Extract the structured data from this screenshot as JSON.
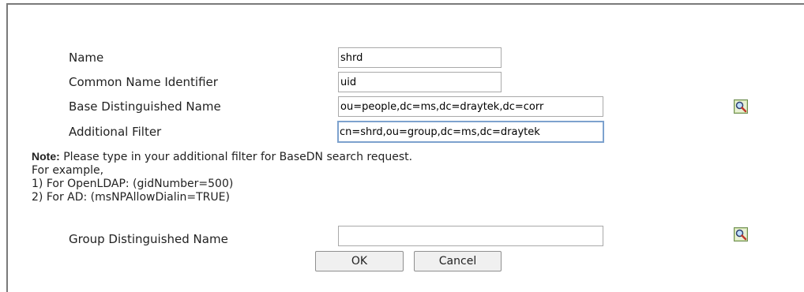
{
  "form": {
    "name_label": "Name",
    "name_value": "shrd",
    "cn_label": "Common Name Identifier",
    "cn_value": "uid",
    "base_dn_label": "Base Distinguished Name",
    "base_dn_value": "ou=people,dc=ms,dc=draytek,dc=corr",
    "filter_label": "Additional Filter",
    "filter_value": "cn=shrd,ou=group,dc=ms,dc=draytek",
    "group_dn_label": "Group Distinguished Name",
    "group_dn_value": ""
  },
  "note": {
    "label": "Note:",
    "line1": " Please type in your additional filter for BaseDN search request.",
    "line2": "For example,",
    "line3": "1) For OpenLDAP: (gidNumber=500)",
    "line4": "2) For AD: (msNPAllowDialin=TRUE)"
  },
  "buttons": {
    "ok": "OK",
    "cancel": "Cancel"
  },
  "icons": {
    "base_dn_search": "magnifier-search-icon",
    "group_dn_search": "magnifier-search-icon"
  }
}
